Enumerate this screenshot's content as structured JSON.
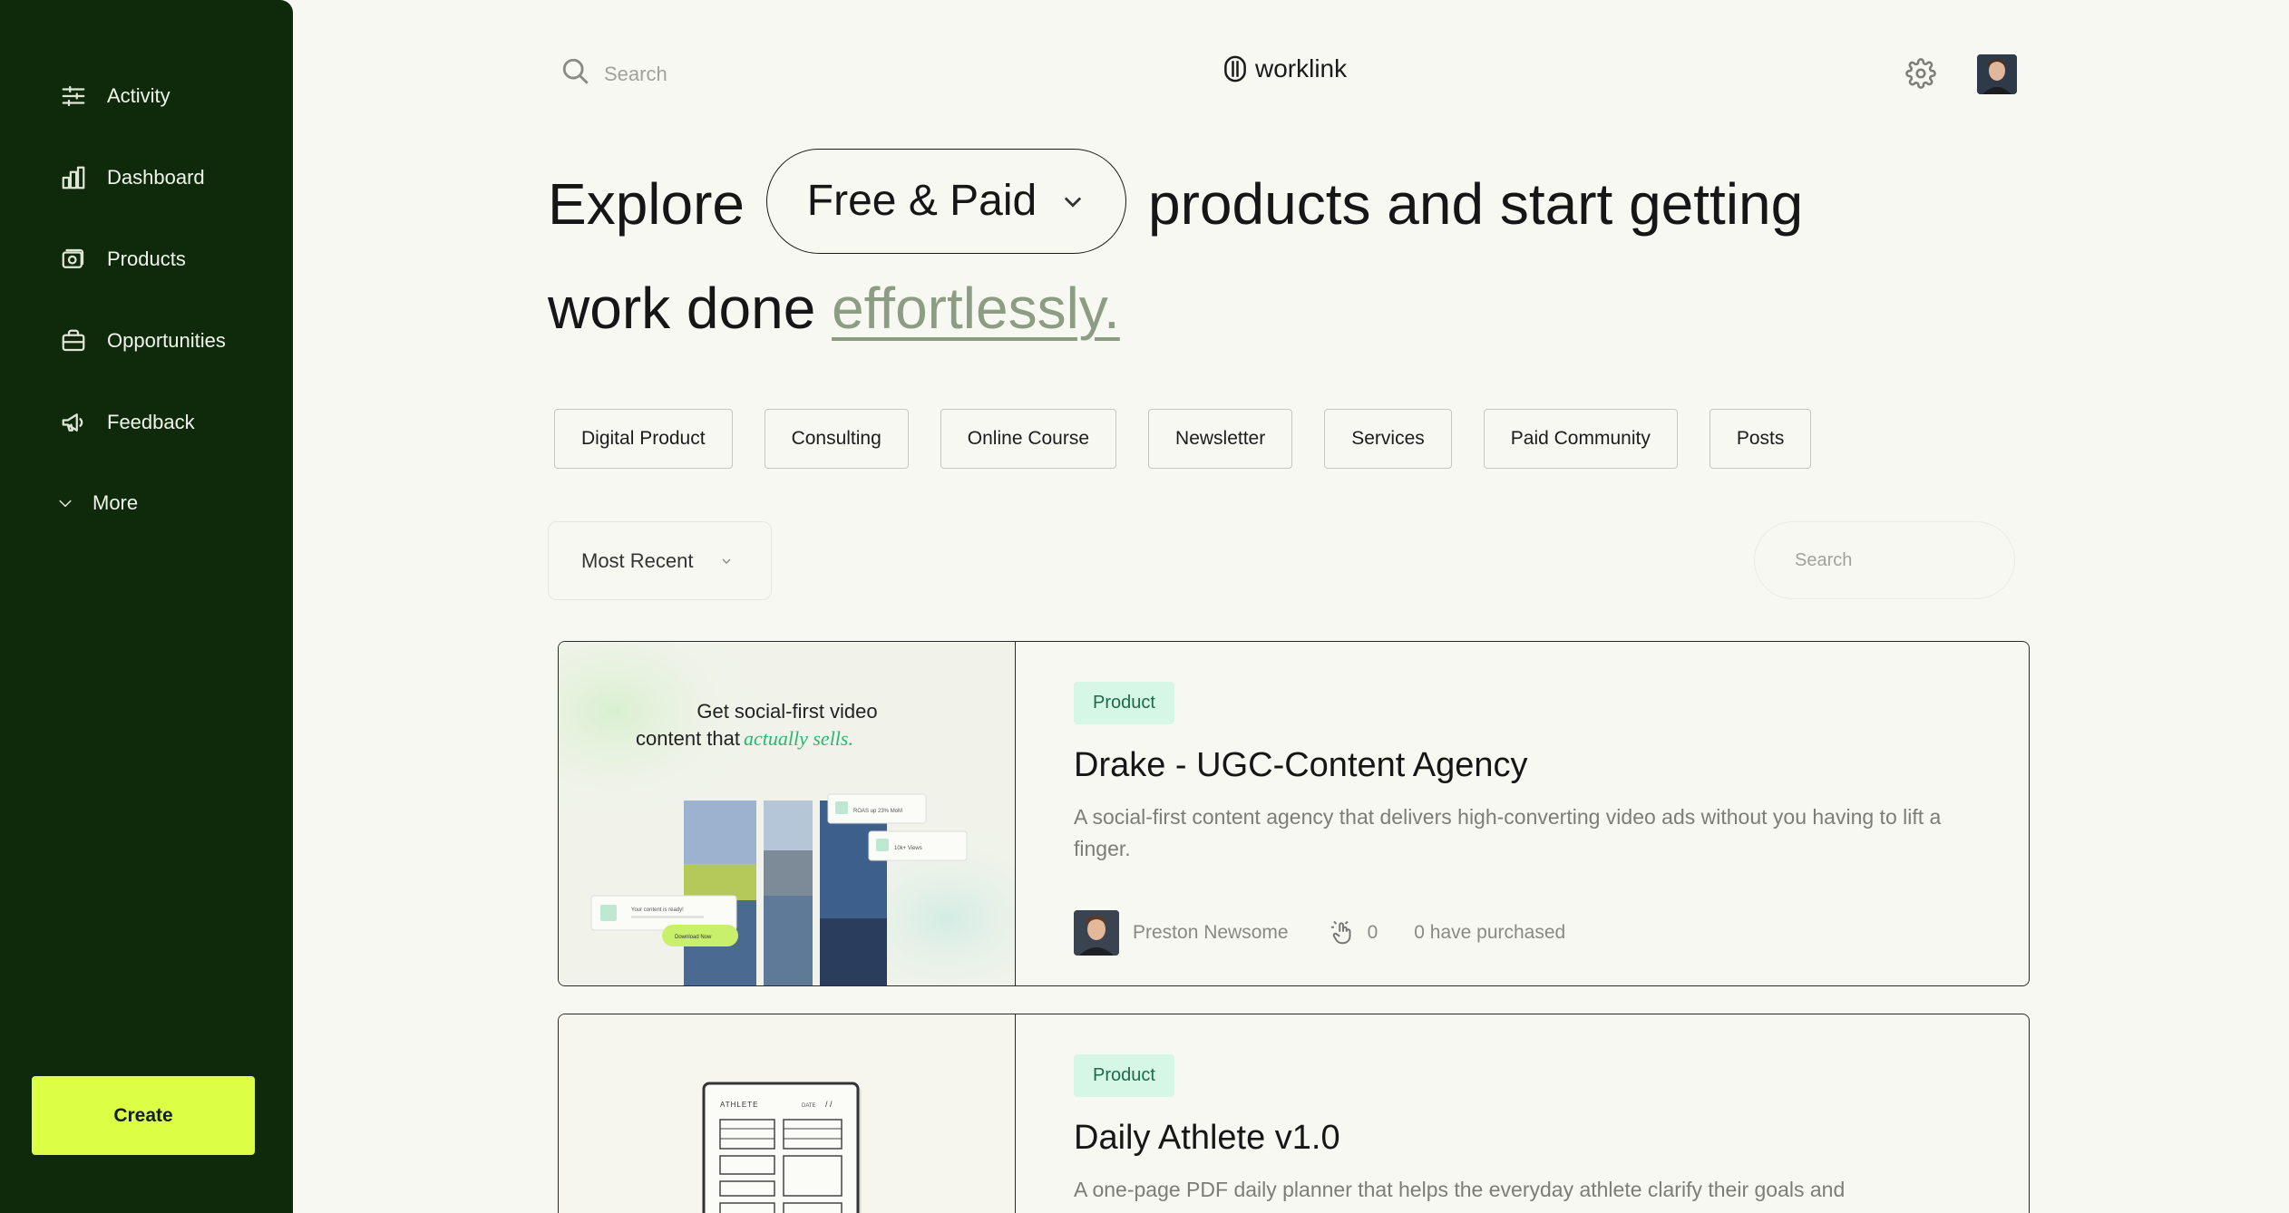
{
  "sidebar": {
    "items": [
      {
        "label": "Activity",
        "icon": "sliders-icon"
      },
      {
        "label": "Dashboard",
        "icon": "bar-chart-icon"
      },
      {
        "label": "Products",
        "icon": "camera-icon"
      },
      {
        "label": "Opportunities",
        "icon": "briefcase-icon"
      },
      {
        "label": "Feedback",
        "icon": "megaphone-icon"
      }
    ],
    "more_label": "More",
    "create_label": "Create"
  },
  "topbar": {
    "search_placeholder": "Search",
    "brand": "worklink"
  },
  "hero": {
    "pre": "Explore",
    "filter_value": "Free & Paid",
    "post": "products and start getting",
    "line2": "work done",
    "emphasis": "effortlessly."
  },
  "categories": [
    "Digital Product",
    "Consulting",
    "Online Course",
    "Newsletter",
    "Services",
    "Paid Community",
    "Posts"
  ],
  "sort": {
    "value": "Most Recent"
  },
  "list_search_placeholder": "Search",
  "products": [
    {
      "badge": "Product",
      "title": "Drake - UGC-Content Agency",
      "description": "A social-first content agency that delivers high-converting video ads without you having to lift a finger.",
      "author": "Preston Newsome",
      "clicks": "0",
      "purchased": "0 have purchased",
      "thumb": {
        "headline_1": "Get social-first video",
        "headline_2": "content that",
        "headline_accent": "actually sells.",
        "stat_1": "ROAS up 23% MoM",
        "stat_2": "10k+ Views",
        "toast": "Your content is ready!",
        "download": "Download Now"
      }
    },
    {
      "badge": "Product",
      "title": "Daily Athlete v1.0",
      "description": "A one-page PDF daily planner that helps the everyday athlete clarify their goals and",
      "thumb": {
        "sheet_title": "ATHLETE",
        "sheet_meta": "DATE",
        "sheet_slash": "/ /"
      }
    }
  ]
}
